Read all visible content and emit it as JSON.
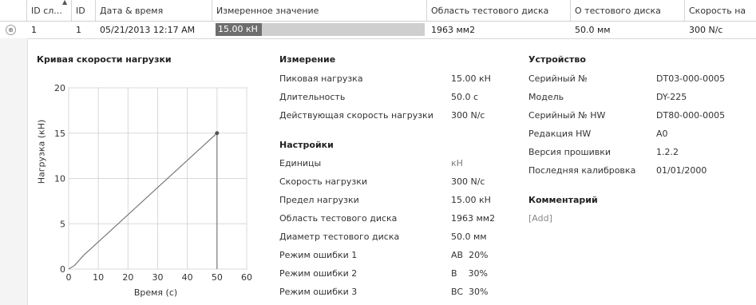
{
  "grid": {
    "columns": [
      "ID сл...",
      "ID",
      "Дата & время",
      "Измеренное значение",
      "Область тестового диска",
      "О тестового диска",
      "Скорость на"
    ],
    "row": {
      "expander_glyph": "⊕",
      "id_sl": "1",
      "id": "1",
      "datetime": "05/21/2013 12:17 AM",
      "measured_value": "15.00 кН",
      "measured_fraction": 0.22,
      "area": "1963 мм2",
      "diameter": "50.0 мм",
      "rate": "300 N/c"
    }
  },
  "measurement": {
    "title": "Измерение",
    "items": [
      {
        "label": "Пиковая нагрузка",
        "value": "15.00 кН"
      },
      {
        "label": "Длительность",
        "value": "50.0 с"
      },
      {
        "label": "Действующая скорость нагрузки",
        "value": "300 N/c"
      }
    ]
  },
  "settings": {
    "title": "Настройки",
    "items": [
      {
        "label": "Единицы",
        "value": "кН"
      },
      {
        "label": "Скорость нагрузки",
        "value": "300 N/c"
      },
      {
        "label": "Предел нагрузки",
        "value": "15.00 кН"
      },
      {
        "label": "Область тестового диска",
        "value": "1963 мм2"
      },
      {
        "label": "Диаметр тестового диска",
        "value": "50.0 мм"
      },
      {
        "label": "Режим ошибки 1",
        "value": "AB  20%"
      },
      {
        "label": "Режим ошибки 2",
        "value": "B    30%"
      },
      {
        "label": "Режим ошибки 3",
        "value": "BC  30%"
      }
    ]
  },
  "device": {
    "title": "Устройство",
    "items": [
      {
        "label": "Серийный №",
        "value": "DT03-000-0005"
      },
      {
        "label": "Модель",
        "value": "DY-225"
      },
      {
        "label": "Серийный № HW",
        "value": "DT80-000-0005"
      },
      {
        "label": "Редакция HW",
        "value": "A0"
      },
      {
        "label": "Версия прошивки",
        "value": "1.2.2"
      },
      {
        "label": "Последняя калибровка",
        "value": "01/01/2000"
      }
    ]
  },
  "comment": {
    "title": "Комментарий",
    "add_label": "[Add]"
  },
  "chart_data": {
    "type": "line",
    "title": "Кривая скорости нагрузки",
    "xlabel": "Время (с)",
    "ylabel": "Нагрузка (кН)",
    "xlim": [
      0,
      60
    ],
    "ylim": [
      0,
      20
    ],
    "xticks": [
      0,
      10,
      20,
      30,
      40,
      50,
      60
    ],
    "yticks": [
      0,
      5,
      10,
      15,
      20
    ],
    "grid": true,
    "series": [
      {
        "x": [
          0,
          2,
          5,
          10,
          20,
          30,
          40,
          50,
          50
        ],
        "y": [
          0,
          0.4,
          1.5,
          3.0,
          6.0,
          9.0,
          12.0,
          15.0,
          0
        ],
        "color": "#7a7a7a"
      }
    ],
    "peak_marker": {
      "x": 50,
      "y": 15.0
    }
  }
}
